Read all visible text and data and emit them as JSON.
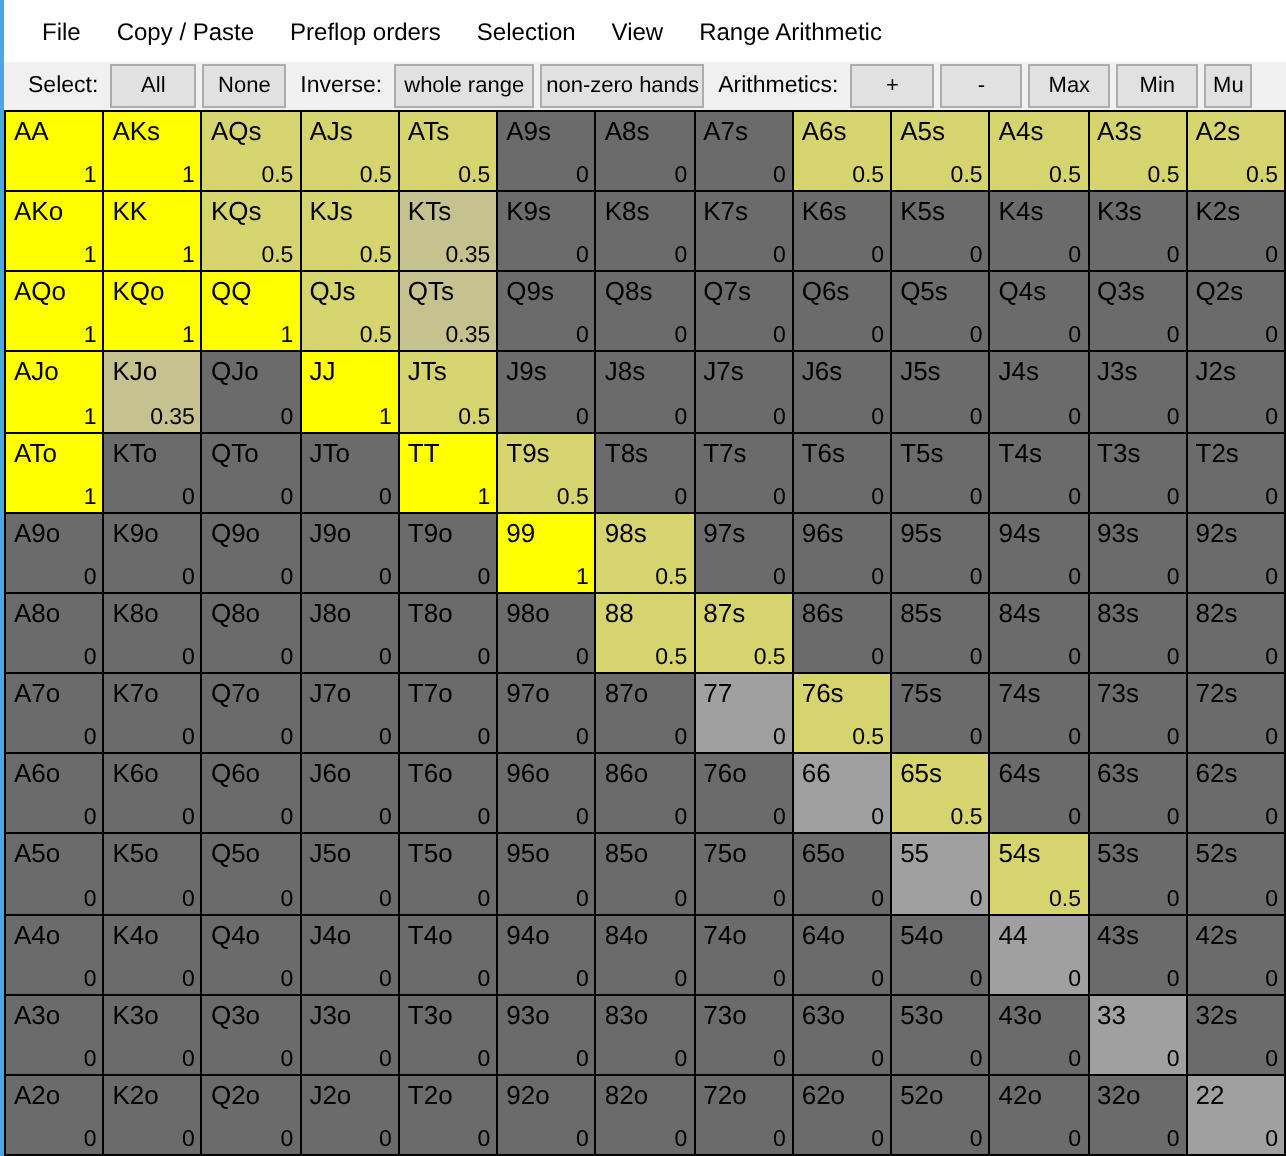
{
  "menu": [
    "File",
    "Copy / Paste",
    "Preflop orders",
    "Selection",
    "View",
    "Range Arithmetic"
  ],
  "toolbar": [
    {
      "kind": "label",
      "text": "Select:"
    },
    {
      "kind": "button",
      "text": "All"
    },
    {
      "kind": "button",
      "text": "None"
    },
    {
      "kind": "label",
      "text": "Inverse:"
    },
    {
      "kind": "button",
      "text": "whole range"
    },
    {
      "kind": "button",
      "text": "non-zero hands"
    },
    {
      "kind": "label",
      "text": "Arithmetics:"
    },
    {
      "kind": "button",
      "text": "+"
    },
    {
      "kind": "button",
      "text": "-"
    },
    {
      "kind": "button",
      "text": "Max"
    },
    {
      "kind": "button",
      "text": "Min"
    },
    {
      "kind": "button",
      "text": "Mu"
    }
  ],
  "grid": [
    [
      {
        "hand": "AA",
        "value": "1",
        "color": "#ffff00"
      },
      {
        "hand": "AKs",
        "value": "1",
        "color": "#ffff00"
      },
      {
        "hand": "AQs",
        "value": "0.5",
        "color": "#d6d46e"
      },
      {
        "hand": "AJs",
        "value": "0.5",
        "color": "#d6d46e"
      },
      {
        "hand": "ATs",
        "value": "0.5",
        "color": "#d6d46e"
      },
      {
        "hand": "A9s",
        "value": "0",
        "color": "#6b6b6b"
      },
      {
        "hand": "A8s",
        "value": "0",
        "color": "#6b6b6b"
      },
      {
        "hand": "A7s",
        "value": "0",
        "color": "#6b6b6b"
      },
      {
        "hand": "A6s",
        "value": "0.5",
        "color": "#d6d46e"
      },
      {
        "hand": "A5s",
        "value": "0.5",
        "color": "#d6d46e"
      },
      {
        "hand": "A4s",
        "value": "0.5",
        "color": "#d6d46e"
      },
      {
        "hand": "A3s",
        "value": "0.5",
        "color": "#d6d46e"
      },
      {
        "hand": "A2s",
        "value": "0.5",
        "color": "#d6d46e"
      }
    ],
    [
      {
        "hand": "AKo",
        "value": "1",
        "color": "#ffff00"
      },
      {
        "hand": "KK",
        "value": "1",
        "color": "#ffff00"
      },
      {
        "hand": "KQs",
        "value": "0.5",
        "color": "#d6d46e"
      },
      {
        "hand": "KJs",
        "value": "0.5",
        "color": "#d6d46e"
      },
      {
        "hand": "KTs",
        "value": "0.35",
        "color": "#c6c290"
      },
      {
        "hand": "K9s",
        "value": "0",
        "color": "#6b6b6b"
      },
      {
        "hand": "K8s",
        "value": "0",
        "color": "#6b6b6b"
      },
      {
        "hand": "K7s",
        "value": "0",
        "color": "#6b6b6b"
      },
      {
        "hand": "K6s",
        "value": "0",
        "color": "#6b6b6b"
      },
      {
        "hand": "K5s",
        "value": "0",
        "color": "#6b6b6b"
      },
      {
        "hand": "K4s",
        "value": "0",
        "color": "#6b6b6b"
      },
      {
        "hand": "K3s",
        "value": "0",
        "color": "#6b6b6b"
      },
      {
        "hand": "K2s",
        "value": "0",
        "color": "#6b6b6b"
      }
    ],
    [
      {
        "hand": "AQo",
        "value": "1",
        "color": "#ffff00"
      },
      {
        "hand": "KQo",
        "value": "1",
        "color": "#ffff00"
      },
      {
        "hand": "QQ",
        "value": "1",
        "color": "#ffff00"
      },
      {
        "hand": "QJs",
        "value": "0.5",
        "color": "#d6d46e"
      },
      {
        "hand": "QTs",
        "value": "0.35",
        "color": "#c6c290"
      },
      {
        "hand": "Q9s",
        "value": "0",
        "color": "#6b6b6b"
      },
      {
        "hand": "Q8s",
        "value": "0",
        "color": "#6b6b6b"
      },
      {
        "hand": "Q7s",
        "value": "0",
        "color": "#6b6b6b"
      },
      {
        "hand": "Q6s",
        "value": "0",
        "color": "#6b6b6b"
      },
      {
        "hand": "Q5s",
        "value": "0",
        "color": "#6b6b6b"
      },
      {
        "hand": "Q4s",
        "value": "0",
        "color": "#6b6b6b"
      },
      {
        "hand": "Q3s",
        "value": "0",
        "color": "#6b6b6b"
      },
      {
        "hand": "Q2s",
        "value": "0",
        "color": "#6b6b6b"
      }
    ],
    [
      {
        "hand": "AJo",
        "value": "1",
        "color": "#ffff00"
      },
      {
        "hand": "KJo",
        "value": "0.35",
        "color": "#c6c290"
      },
      {
        "hand": "QJo",
        "value": "0",
        "color": "#6b6b6b"
      },
      {
        "hand": "JJ",
        "value": "1",
        "color": "#ffff00"
      },
      {
        "hand": "JTs",
        "value": "0.5",
        "color": "#d6d46e"
      },
      {
        "hand": "J9s",
        "value": "0",
        "color": "#6b6b6b"
      },
      {
        "hand": "J8s",
        "value": "0",
        "color": "#6b6b6b"
      },
      {
        "hand": "J7s",
        "value": "0",
        "color": "#6b6b6b"
      },
      {
        "hand": "J6s",
        "value": "0",
        "color": "#6b6b6b"
      },
      {
        "hand": "J5s",
        "value": "0",
        "color": "#6b6b6b"
      },
      {
        "hand": "J4s",
        "value": "0",
        "color": "#6b6b6b"
      },
      {
        "hand": "J3s",
        "value": "0",
        "color": "#6b6b6b"
      },
      {
        "hand": "J2s",
        "value": "0",
        "color": "#6b6b6b"
      }
    ],
    [
      {
        "hand": "ATo",
        "value": "1",
        "color": "#ffff00"
      },
      {
        "hand": "KTo",
        "value": "0",
        "color": "#6b6b6b"
      },
      {
        "hand": "QTo",
        "value": "0",
        "color": "#6b6b6b"
      },
      {
        "hand": "JTo",
        "value": "0",
        "color": "#6b6b6b"
      },
      {
        "hand": "TT",
        "value": "1",
        "color": "#ffff00"
      },
      {
        "hand": "T9s",
        "value": "0.5",
        "color": "#d6d46e"
      },
      {
        "hand": "T8s",
        "value": "0",
        "color": "#6b6b6b"
      },
      {
        "hand": "T7s",
        "value": "0",
        "color": "#6b6b6b"
      },
      {
        "hand": "T6s",
        "value": "0",
        "color": "#6b6b6b"
      },
      {
        "hand": "T5s",
        "value": "0",
        "color": "#6b6b6b"
      },
      {
        "hand": "T4s",
        "value": "0",
        "color": "#6b6b6b"
      },
      {
        "hand": "T3s",
        "value": "0",
        "color": "#6b6b6b"
      },
      {
        "hand": "T2s",
        "value": "0",
        "color": "#6b6b6b"
      }
    ],
    [
      {
        "hand": "A9o",
        "value": "0",
        "color": "#6b6b6b"
      },
      {
        "hand": "K9o",
        "value": "0",
        "color": "#6b6b6b"
      },
      {
        "hand": "Q9o",
        "value": "0",
        "color": "#6b6b6b"
      },
      {
        "hand": "J9o",
        "value": "0",
        "color": "#6b6b6b"
      },
      {
        "hand": "T9o",
        "value": "0",
        "color": "#6b6b6b"
      },
      {
        "hand": "99",
        "value": "1",
        "color": "#ffff00"
      },
      {
        "hand": "98s",
        "value": "0.5",
        "color": "#d6d46e"
      },
      {
        "hand": "97s",
        "value": "0",
        "color": "#6b6b6b"
      },
      {
        "hand": "96s",
        "value": "0",
        "color": "#6b6b6b"
      },
      {
        "hand": "95s",
        "value": "0",
        "color": "#6b6b6b"
      },
      {
        "hand": "94s",
        "value": "0",
        "color": "#6b6b6b"
      },
      {
        "hand": "93s",
        "value": "0",
        "color": "#6b6b6b"
      },
      {
        "hand": "92s",
        "value": "0",
        "color": "#6b6b6b"
      }
    ],
    [
      {
        "hand": "A8o",
        "value": "0",
        "color": "#6b6b6b"
      },
      {
        "hand": "K8o",
        "value": "0",
        "color": "#6b6b6b"
      },
      {
        "hand": "Q8o",
        "value": "0",
        "color": "#6b6b6b"
      },
      {
        "hand": "J8o",
        "value": "0",
        "color": "#6b6b6b"
      },
      {
        "hand": "T8o",
        "value": "0",
        "color": "#6b6b6b"
      },
      {
        "hand": "98o",
        "value": "0",
        "color": "#6b6b6b"
      },
      {
        "hand": "88",
        "value": "0.5",
        "color": "#d6d46e"
      },
      {
        "hand": "87s",
        "value": "0.5",
        "color": "#d6d46e"
      },
      {
        "hand": "86s",
        "value": "0",
        "color": "#6b6b6b"
      },
      {
        "hand": "85s",
        "value": "0",
        "color": "#6b6b6b"
      },
      {
        "hand": "84s",
        "value": "0",
        "color": "#6b6b6b"
      },
      {
        "hand": "83s",
        "value": "0",
        "color": "#6b6b6b"
      },
      {
        "hand": "82s",
        "value": "0",
        "color": "#6b6b6b"
      }
    ],
    [
      {
        "hand": "A7o",
        "value": "0",
        "color": "#6b6b6b"
      },
      {
        "hand": "K7o",
        "value": "0",
        "color": "#6b6b6b"
      },
      {
        "hand": "Q7o",
        "value": "0",
        "color": "#6b6b6b"
      },
      {
        "hand": "J7o",
        "value": "0",
        "color": "#6b6b6b"
      },
      {
        "hand": "T7o",
        "value": "0",
        "color": "#6b6b6b"
      },
      {
        "hand": "97o",
        "value": "0",
        "color": "#6b6b6b"
      },
      {
        "hand": "87o",
        "value": "0",
        "color": "#6b6b6b"
      },
      {
        "hand": "77",
        "value": "0",
        "color": "#a0a0a0"
      },
      {
        "hand": "76s",
        "value": "0.5",
        "color": "#d6d46e"
      },
      {
        "hand": "75s",
        "value": "0",
        "color": "#6b6b6b"
      },
      {
        "hand": "74s",
        "value": "0",
        "color": "#6b6b6b"
      },
      {
        "hand": "73s",
        "value": "0",
        "color": "#6b6b6b"
      },
      {
        "hand": "72s",
        "value": "0",
        "color": "#6b6b6b"
      }
    ],
    [
      {
        "hand": "A6o",
        "value": "0",
        "color": "#6b6b6b"
      },
      {
        "hand": "K6o",
        "value": "0",
        "color": "#6b6b6b"
      },
      {
        "hand": "Q6o",
        "value": "0",
        "color": "#6b6b6b"
      },
      {
        "hand": "J6o",
        "value": "0",
        "color": "#6b6b6b"
      },
      {
        "hand": "T6o",
        "value": "0",
        "color": "#6b6b6b"
      },
      {
        "hand": "96o",
        "value": "0",
        "color": "#6b6b6b"
      },
      {
        "hand": "86o",
        "value": "0",
        "color": "#6b6b6b"
      },
      {
        "hand": "76o",
        "value": "0",
        "color": "#6b6b6b"
      },
      {
        "hand": "66",
        "value": "0",
        "color": "#a0a0a0"
      },
      {
        "hand": "65s",
        "value": "0.5",
        "color": "#d6d46e"
      },
      {
        "hand": "64s",
        "value": "0",
        "color": "#6b6b6b"
      },
      {
        "hand": "63s",
        "value": "0",
        "color": "#6b6b6b"
      },
      {
        "hand": "62s",
        "value": "0",
        "color": "#6b6b6b"
      }
    ],
    [
      {
        "hand": "A5o",
        "value": "0",
        "color": "#6b6b6b"
      },
      {
        "hand": "K5o",
        "value": "0",
        "color": "#6b6b6b"
      },
      {
        "hand": "Q5o",
        "value": "0",
        "color": "#6b6b6b"
      },
      {
        "hand": "J5o",
        "value": "0",
        "color": "#6b6b6b"
      },
      {
        "hand": "T5o",
        "value": "0",
        "color": "#6b6b6b"
      },
      {
        "hand": "95o",
        "value": "0",
        "color": "#6b6b6b"
      },
      {
        "hand": "85o",
        "value": "0",
        "color": "#6b6b6b"
      },
      {
        "hand": "75o",
        "value": "0",
        "color": "#6b6b6b"
      },
      {
        "hand": "65o",
        "value": "0",
        "color": "#6b6b6b"
      },
      {
        "hand": "55",
        "value": "0",
        "color": "#a0a0a0"
      },
      {
        "hand": "54s",
        "value": "0.5",
        "color": "#d6d46e"
      },
      {
        "hand": "53s",
        "value": "0",
        "color": "#6b6b6b"
      },
      {
        "hand": "52s",
        "value": "0",
        "color": "#6b6b6b"
      }
    ],
    [
      {
        "hand": "A4o",
        "value": "0",
        "color": "#6b6b6b"
      },
      {
        "hand": "K4o",
        "value": "0",
        "color": "#6b6b6b"
      },
      {
        "hand": "Q4o",
        "value": "0",
        "color": "#6b6b6b"
      },
      {
        "hand": "J4o",
        "value": "0",
        "color": "#6b6b6b"
      },
      {
        "hand": "T4o",
        "value": "0",
        "color": "#6b6b6b"
      },
      {
        "hand": "94o",
        "value": "0",
        "color": "#6b6b6b"
      },
      {
        "hand": "84o",
        "value": "0",
        "color": "#6b6b6b"
      },
      {
        "hand": "74o",
        "value": "0",
        "color": "#6b6b6b"
      },
      {
        "hand": "64o",
        "value": "0",
        "color": "#6b6b6b"
      },
      {
        "hand": "54o",
        "value": "0",
        "color": "#6b6b6b"
      },
      {
        "hand": "44",
        "value": "0",
        "color": "#a0a0a0"
      },
      {
        "hand": "43s",
        "value": "0",
        "color": "#6b6b6b"
      },
      {
        "hand": "42s",
        "value": "0",
        "color": "#6b6b6b"
      }
    ],
    [
      {
        "hand": "A3o",
        "value": "0",
        "color": "#6b6b6b"
      },
      {
        "hand": "K3o",
        "value": "0",
        "color": "#6b6b6b"
      },
      {
        "hand": "Q3o",
        "value": "0",
        "color": "#6b6b6b"
      },
      {
        "hand": "J3o",
        "value": "0",
        "color": "#6b6b6b"
      },
      {
        "hand": "T3o",
        "value": "0",
        "color": "#6b6b6b"
      },
      {
        "hand": "93o",
        "value": "0",
        "color": "#6b6b6b"
      },
      {
        "hand": "83o",
        "value": "0",
        "color": "#6b6b6b"
      },
      {
        "hand": "73o",
        "value": "0",
        "color": "#6b6b6b"
      },
      {
        "hand": "63o",
        "value": "0",
        "color": "#6b6b6b"
      },
      {
        "hand": "53o",
        "value": "0",
        "color": "#6b6b6b"
      },
      {
        "hand": "43o",
        "value": "0",
        "color": "#6b6b6b"
      },
      {
        "hand": "33",
        "value": "0",
        "color": "#a0a0a0"
      },
      {
        "hand": "32s",
        "value": "0",
        "color": "#6b6b6b"
      }
    ],
    [
      {
        "hand": "A2o",
        "value": "0",
        "color": "#6b6b6b"
      },
      {
        "hand": "K2o",
        "value": "0",
        "color": "#6b6b6b"
      },
      {
        "hand": "Q2o",
        "value": "0",
        "color": "#6b6b6b"
      },
      {
        "hand": "J2o",
        "value": "0",
        "color": "#6b6b6b"
      },
      {
        "hand": "T2o",
        "value": "0",
        "color": "#6b6b6b"
      },
      {
        "hand": "92o",
        "value": "0",
        "color": "#6b6b6b"
      },
      {
        "hand": "82o",
        "value": "0",
        "color": "#6b6b6b"
      },
      {
        "hand": "72o",
        "value": "0",
        "color": "#6b6b6b"
      },
      {
        "hand": "62o",
        "value": "0",
        "color": "#6b6b6b"
      },
      {
        "hand": "52o",
        "value": "0",
        "color": "#6b6b6b"
      },
      {
        "hand": "42o",
        "value": "0",
        "color": "#6b6b6b"
      },
      {
        "hand": "32o",
        "value": "0",
        "color": "#6b6b6b"
      },
      {
        "hand": "22",
        "value": "0",
        "color": "#a0a0a0"
      }
    ]
  ]
}
